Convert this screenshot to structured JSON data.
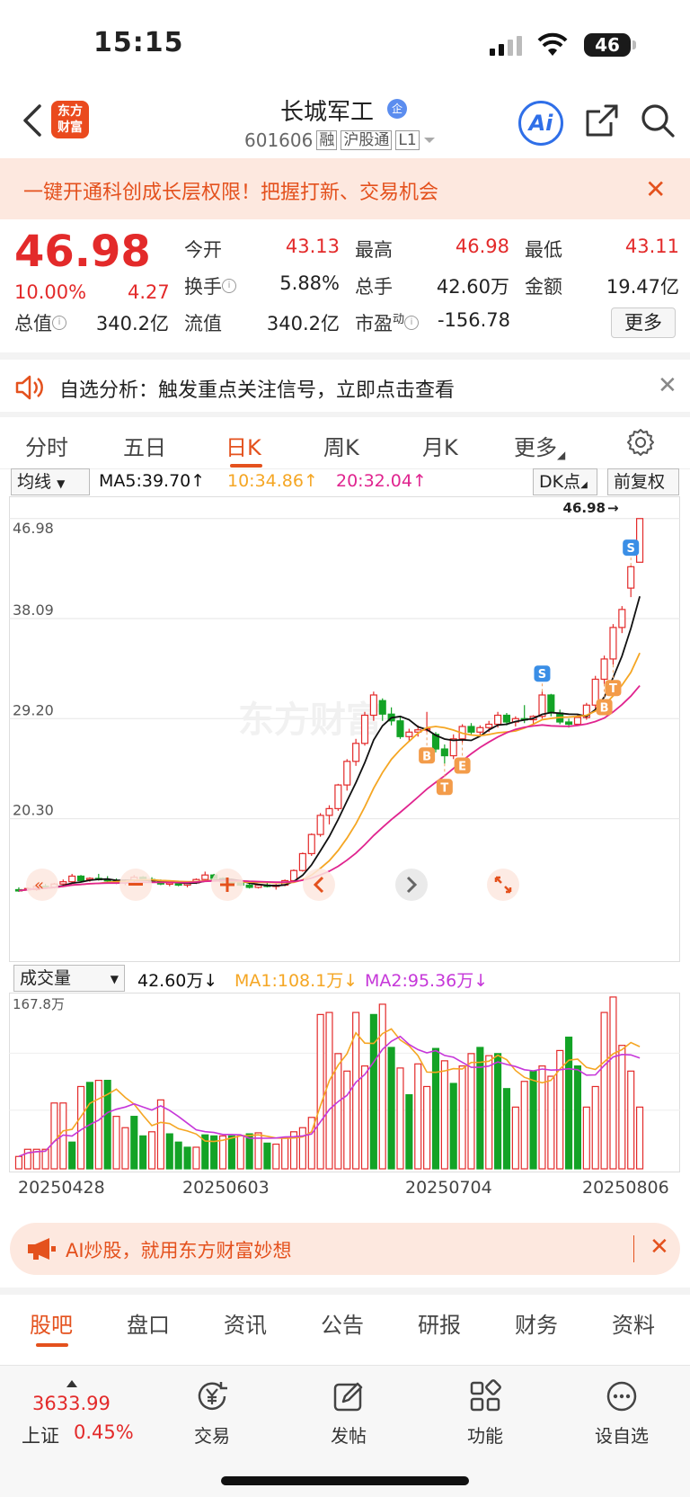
{
  "status_bar": {
    "time": "15:15",
    "battery": "46"
  },
  "header": {
    "logo_text": "东方\n财富",
    "stock_name": "长城军工",
    "badge": "企",
    "code": "601606",
    "tags": [
      "融",
      "沪股通",
      "L1"
    ],
    "ai_label": "Ai"
  },
  "promo": {
    "text": "一键开通科创成长层权限！把握打新、交易机会",
    "close": "✕"
  },
  "quote": {
    "price": "46.98",
    "pct": "10.00%",
    "change": "4.27",
    "open_label": "今开",
    "open": "43.13",
    "high_label": "最高",
    "high": "46.98",
    "low_label": "最低",
    "low": "43.11",
    "turnover_label": "换手",
    "turnover": "5.88%",
    "volume_label": "总手",
    "volume": "42.60万",
    "amount_label": "金额",
    "amount": "19.47亿",
    "mcap_label": "总值",
    "mcap": "340.2亿",
    "float_label": "流值",
    "float": "340.2亿",
    "pe_label": "市盈",
    "pe_sup": "动",
    "pe": "-156.78",
    "more": "更多"
  },
  "alert": {
    "text": "自选分析：触发重点关注信号，立即点击查看",
    "close": "✕"
  },
  "period_tabs": [
    "分时",
    "五日",
    "日K",
    "周K",
    "月K",
    "更多",
    ""
  ],
  "kline_legend": {
    "indicator": "均线",
    "ma5": "MA5:39.70↑",
    "ma10": "10:34.86↑",
    "ma20": "20:32.04↑",
    "dk": "DK点",
    "adjust": "前复权",
    "colors": {
      "ma5": "#111111",
      "ma10": "#f5a623",
      "ma20": "#e0248f",
      "up": "#e32a2a",
      "down": "#13a326"
    }
  },
  "vol_legend": {
    "indicator": "成交量",
    "vol": "42.60万↓",
    "ma1": "MA1:108.1万↓",
    "ma2": "MA2:95.36万↓"
  },
  "chart_data": [
    {
      "type": "candlestick",
      "y_ticks": [
        "46.98",
        "38.09",
        "29.20",
        "20.30"
      ],
      "ylim": [
        11.4,
        48.0
      ],
      "last_price_label": "46.98",
      "watermark": "东方财富",
      "x_ticks": [
        "20250428",
        "20250603",
        "20250704",
        "20250806"
      ],
      "candles": [
        [
          14.0,
          14.2,
          13.8,
          13.9
        ],
        [
          14.1,
          14.2,
          13.9,
          14.1
        ],
        [
          14.0,
          14.4,
          13.9,
          14.3
        ],
        [
          14.3,
          14.5,
          14.1,
          14.2
        ],
        [
          14.2,
          14.6,
          14.1,
          14.5
        ],
        [
          14.5,
          14.9,
          14.3,
          14.7
        ],
        [
          14.7,
          15.4,
          14.6,
          15.2
        ],
        [
          15.2,
          15.3,
          14.7,
          14.8
        ],
        [
          14.9,
          15.1,
          14.7,
          15.0
        ],
        [
          15.0,
          15.4,
          14.8,
          14.9
        ],
        [
          14.9,
          15.2,
          14.6,
          14.8
        ],
        [
          14.8,
          15.0,
          14.5,
          14.6
        ],
        [
          14.6,
          14.9,
          14.4,
          14.8
        ],
        [
          14.8,
          15.3,
          14.7,
          15.1
        ],
        [
          15.1,
          15.2,
          14.8,
          14.9
        ],
        [
          14.9,
          15.1,
          14.6,
          14.7
        ],
        [
          14.7,
          14.9,
          14.4,
          14.5
        ],
        [
          14.5,
          14.8,
          14.3,
          14.6
        ],
        [
          14.6,
          14.8,
          14.3,
          14.4
        ],
        [
          14.4,
          14.7,
          14.2,
          14.6
        ],
        [
          14.6,
          15.0,
          14.5,
          14.9
        ],
        [
          14.9,
          15.6,
          14.8,
          15.3
        ],
        [
          15.3,
          15.4,
          14.9,
          15.0
        ],
        [
          15.0,
          15.1,
          14.6,
          14.7
        ],
        [
          14.7,
          14.9,
          14.5,
          14.6
        ],
        [
          14.6,
          14.8,
          14.3,
          14.4
        ],
        [
          14.4,
          14.6,
          14.1,
          14.2
        ],
        [
          14.2,
          14.5,
          14.1,
          14.4
        ],
        [
          14.4,
          14.7,
          14.2,
          14.3
        ],
        [
          14.3,
          14.5,
          14.0,
          14.4
        ],
        [
          14.4,
          14.9,
          14.3,
          14.8
        ],
        [
          14.8,
          15.8,
          14.7,
          15.7
        ],
        [
          15.7,
          17.3,
          15.6,
          17.2
        ],
        [
          17.2,
          19.0,
          17.0,
          18.9
        ],
        [
          18.9,
          20.8,
          18.7,
          20.6
        ],
        [
          20.6,
          21.5,
          19.8,
          21.2
        ],
        [
          21.2,
          23.4,
          21.0,
          23.3
        ],
        [
          23.3,
          25.6,
          22.8,
          25.4
        ],
        [
          25.4,
          27.4,
          25.0,
          27.0
        ],
        [
          27.0,
          29.8,
          26.8,
          29.5
        ],
        [
          29.5,
          31.6,
          29.0,
          31.3
        ],
        [
          30.8,
          31.0,
          29.0,
          29.6
        ],
        [
          29.6,
          30.2,
          28.6,
          29.0
        ],
        [
          29.0,
          29.4,
          27.4,
          27.6
        ],
        [
          27.6,
          28.3,
          27.2,
          28.0
        ],
        [
          28.0,
          28.6,
          27.6,
          28.2
        ],
        [
          28.2,
          29.8,
          28.0,
          28.3
        ],
        [
          27.8,
          28.0,
          26.2,
          26.5
        ],
        [
          26.5,
          26.9,
          25.2,
          25.9
        ],
        [
          25.9,
          27.8,
          25.6,
          27.4
        ],
        [
          27.4,
          28.7,
          27.1,
          28.5
        ],
        [
          28.5,
          28.8,
          27.8,
          28.0
        ],
        [
          28.0,
          28.6,
          27.6,
          28.4
        ],
        [
          28.4,
          29.0,
          28.0,
          28.7
        ],
        [
          28.7,
          29.8,
          28.4,
          29.5
        ],
        [
          29.5,
          29.7,
          28.6,
          28.9
        ],
        [
          28.9,
          29.4,
          28.5,
          29.2
        ],
        [
          29.2,
          30.4,
          28.8,
          29.1
        ],
        [
          29.1,
          29.5,
          28.7,
          29.4
        ],
        [
          29.4,
          31.6,
          29.2,
          31.3
        ],
        [
          31.3,
          31.4,
          29.4,
          29.7
        ],
        [
          29.7,
          30.0,
          28.7,
          28.9
        ],
        [
          28.9,
          29.2,
          28.4,
          28.7
        ],
        [
          28.7,
          29.6,
          28.6,
          29.3
        ],
        [
          29.3,
          30.6,
          29.1,
          30.4
        ],
        [
          30.4,
          33.0,
          30.0,
          32.7
        ],
        [
          32.7,
          34.8,
          32.3,
          34.5
        ],
        [
          34.5,
          37.6,
          34.0,
          37.3
        ],
        [
          37.3,
          39.2,
          36.8,
          38.9
        ],
        [
          40.8,
          42.8,
          40.0,
          42.7
        ],
        [
          43.1,
          47.0,
          43.1,
          46.98
        ]
      ],
      "signals": [
        "B",
        "T",
        "E",
        "S",
        "B",
        "T",
        "S"
      ]
    },
    {
      "type": "bar",
      "title": "成交量",
      "ylim": [
        0,
        167.8
      ],
      "y_tick": "167.8万",
      "unit": "万",
      "values": [
        12,
        19,
        19,
        19,
        64,
        64,
        26,
        80,
        84,
        86,
        86,
        51,
        40,
        51,
        32,
        36,
        67,
        34,
        26,
        21,
        21,
        33,
        32,
        32,
        32,
        32,
        34,
        35,
        25,
        24,
        30,
        36,
        40,
        50,
        150,
        152,
        112,
        95,
        152,
        100,
        150,
        160,
        118,
        98,
        72,
        102,
        80,
        117,
        105,
        83,
        100,
        112,
        118,
        110,
        112,
        78,
        60,
        85,
        95,
        100,
        90,
        115,
        128,
        100,
        60,
        80,
        152,
        167,
        120,
        95,
        60
      ],
      "up": [
        true,
        true,
        true,
        true,
        true,
        true,
        false,
        true,
        false,
        true,
        false,
        true,
        true,
        false,
        false,
        true,
        true,
        false,
        false,
        false,
        true,
        false,
        false,
        true,
        false,
        true,
        false,
        true,
        false,
        true,
        true,
        true,
        true,
        true,
        true,
        true,
        true,
        true,
        true,
        true,
        false,
        true,
        false,
        true,
        false,
        true,
        true,
        false,
        true,
        false,
        true,
        true,
        false,
        true,
        false,
        false,
        true,
        true,
        false,
        true,
        true,
        true,
        false,
        false,
        true,
        true,
        true,
        true,
        true,
        true,
        true
      ]
    }
  ],
  "aibar": {
    "text": "AI炒股，就用东方财富妙想",
    "close": "✕"
  },
  "section_tabs": [
    "股吧",
    "盘口",
    "资讯",
    "公告",
    "研报",
    "财务",
    "资料"
  ],
  "bottom_nav": {
    "index_value": "3633.99",
    "index_name": "上证",
    "index_pct": "0.45%",
    "items": [
      "交易",
      "发帖",
      "功能",
      "设自选"
    ]
  }
}
